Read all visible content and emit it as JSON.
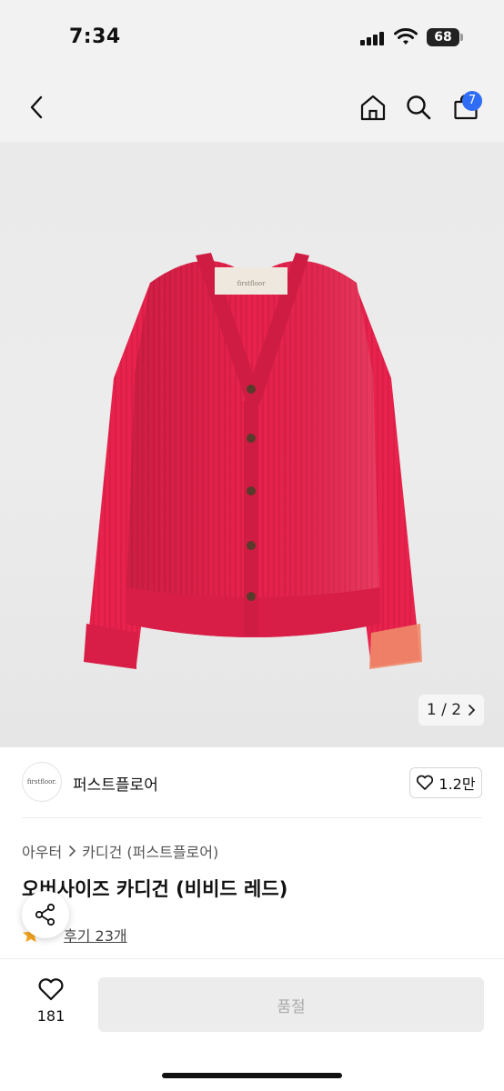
{
  "status": {
    "time": "7:34",
    "battery": "68"
  },
  "header": {
    "cart_count": "7"
  },
  "gallery": {
    "pager": "1 / 2",
    "brand_tag": "firstfloor"
  },
  "brand": {
    "logo_text": "firstfloor.",
    "name": "퍼스트플로어",
    "likes": "1.2만"
  },
  "product": {
    "breadcrumb": [
      "아우터",
      "카디건 (퍼스트플로어)"
    ],
    "title": "오버사이즈 카디건 (비비드 레드)",
    "reviews": "후기 23개"
  },
  "bottom": {
    "wish_count": "181",
    "buy_label": "품절"
  },
  "colors": {
    "accent": "#2f6df6",
    "cardigan": "#e8224c",
    "star": "#f5a623"
  }
}
